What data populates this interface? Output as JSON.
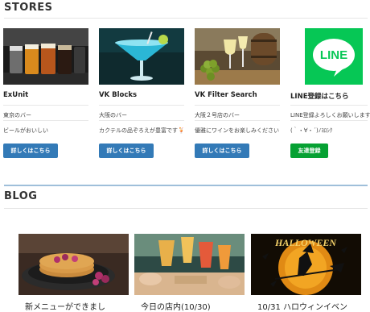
{
  "stores": {
    "title": "STORES",
    "cards": [
      {
        "title": "ExUnit",
        "line1": "東京のバー",
        "line2": "ビールがおいしい",
        "button": "詳しくはこちら",
        "image": "beer-glasses-photo"
      },
      {
        "title": "VK Blocks",
        "line1": "大阪のバー",
        "line2": "カクテルの品ぞろえが豊富です🍹",
        "button": "詳しくはこちら",
        "image": "blue-cocktail-photo"
      },
      {
        "title": "VK Filter Search",
        "line1": "大阪２号店のバー",
        "line2": "優雅にワインをお楽しみください",
        "button": "詳しくはこちら",
        "image": "wine-and-grapes-photo"
      },
      {
        "title": "LINE登録はこちら",
        "line1": "LINE登録よろしくお願いします",
        "line2": "(｀・∀・´)ﾉﾖﾛｼｸ",
        "button": "友達登録",
        "image": "line-logo",
        "logo_text": "LINE"
      }
    ]
  },
  "blog": {
    "title": "BLOG",
    "posts": [
      {
        "caption": "新メニューができまし",
        "image": "pancakes-photo"
      },
      {
        "caption": "今日の店内(10/30)",
        "image": "cocktail-toast-photo"
      },
      {
        "caption": "10/31 ハロウィンイベン",
        "image": "halloween-witch-photo",
        "overlay_text": "HALLOWEEN"
      }
    ]
  },
  "colors": {
    "button_blue": "#337ab7",
    "button_green": "#06a133",
    "line_green": "#06c755",
    "section_rule": "#9fbfda",
    "text": "#333333"
  }
}
